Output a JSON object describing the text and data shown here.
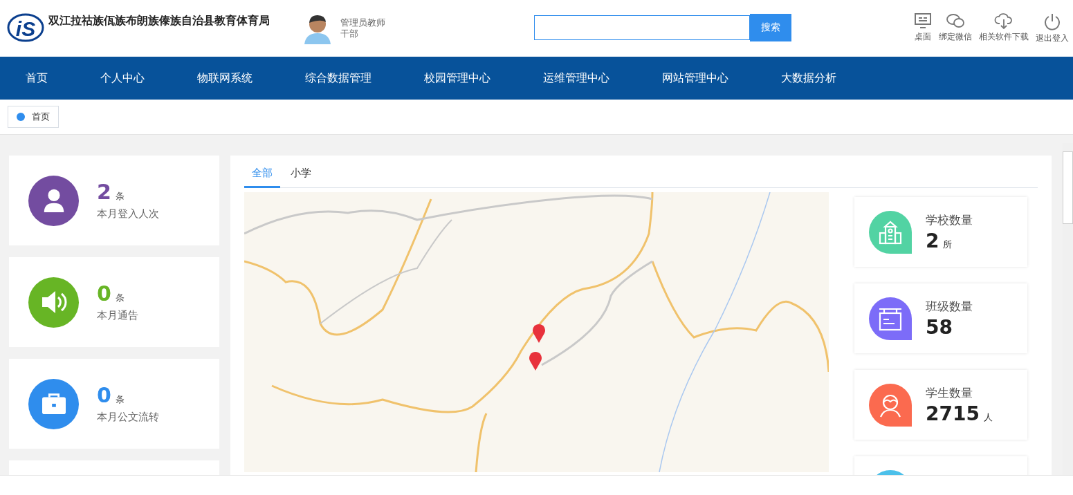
{
  "header": {
    "logo_text": "iS",
    "title": "双江拉祜族佤族布朗族傣族自治县教育体育局",
    "user": {
      "name": "管理员教师",
      "role": "干部"
    },
    "search": {
      "button": "搜索"
    },
    "tools": [
      {
        "label": "桌面"
      },
      {
        "label": "绑定微信"
      },
      {
        "label": "相关软件下载"
      },
      {
        "label": "退出登入"
      }
    ]
  },
  "nav": [
    {
      "label": "首页"
    },
    {
      "label": "个人中心"
    },
    {
      "label": "物联网系统"
    },
    {
      "label": "综合数据管理"
    },
    {
      "label": "校园管理中心"
    },
    {
      "label": "运维管理中心"
    },
    {
      "label": "网站管理中心"
    },
    {
      "label": "大数据分析"
    }
  ],
  "breadcrumb": [
    {
      "label": "首页"
    }
  ],
  "left_stats": [
    {
      "color": "#734ca0",
      "value": "2",
      "unit": "条",
      "label": "本月登入人次"
    },
    {
      "color": "#67b525",
      "value": "0",
      "unit": "条",
      "label": "本月通告"
    },
    {
      "color": "#2f8ded",
      "value": "0",
      "unit": "条",
      "label": "本月公文流转"
    }
  ],
  "tabs": [
    {
      "label": "全部",
      "selected": true
    },
    {
      "label": "小学",
      "selected": false
    }
  ],
  "right_stats": [
    {
      "color": "#52d3a3",
      "label": "学校数量",
      "value": "2",
      "unit": "所"
    },
    {
      "color": "#7c6cf8",
      "label": "班级数量",
      "value": "58"
    },
    {
      "color": "#fb6a4f",
      "label": "学生数量",
      "value": "2715",
      "unit": "人"
    },
    {
      "color": "#4cc0ea"
    }
  ]
}
